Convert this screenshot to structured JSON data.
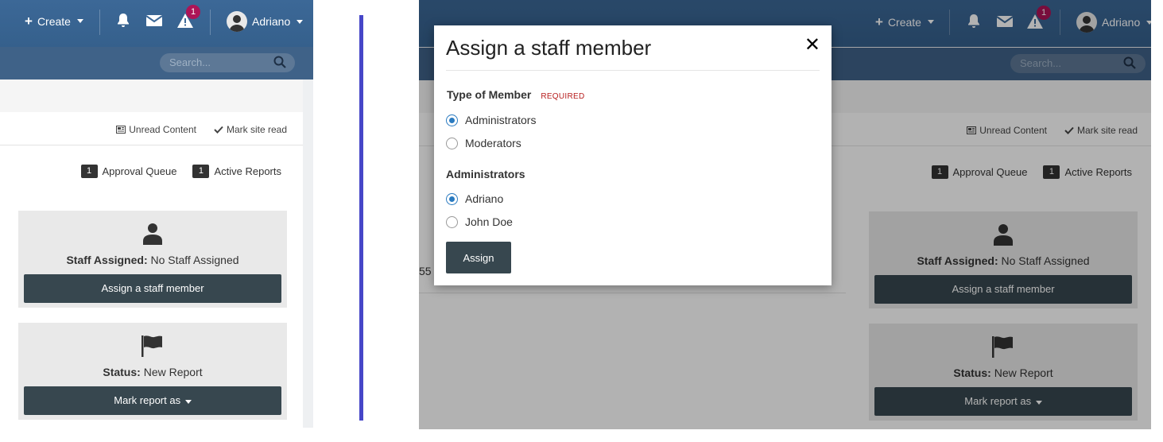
{
  "nav": {
    "create_label": "Create",
    "user_name": "Adriano",
    "alert_badge": "1"
  },
  "search": {
    "placeholder": "Search..."
  },
  "links": {
    "unread": "Unread Content",
    "mark_read": "Mark site read"
  },
  "counts": {
    "approval": {
      "count": "1",
      "label": "Approval Queue"
    },
    "reports": {
      "count": "1",
      "label": "Active Reports"
    }
  },
  "staff_card": {
    "label": "Staff Assigned:",
    "value": "No Staff Assigned",
    "button": "Assign a staff member"
  },
  "status_card": {
    "label": "Status:",
    "value": "New Report",
    "button": "Mark report as"
  },
  "background_fragment": "55",
  "modal": {
    "title": "Assign a staff member",
    "close": "✕",
    "type_label": "Type of Member",
    "required": "REQUIRED",
    "type_options": [
      {
        "label": "Administrators",
        "selected": true
      },
      {
        "label": "Moderators",
        "selected": false
      }
    ],
    "admins_label": "Administrators",
    "admin_options": [
      {
        "label": "Adriano",
        "selected": true
      },
      {
        "label": "John Doe",
        "selected": false
      }
    ],
    "submit": "Assign"
  },
  "colors": {
    "header": "#3c6897",
    "button": "#37474f",
    "badge": "#ad1457",
    "radio": "#2a7ac0",
    "divider": "#4646c8"
  },
  "icons": [
    "plus-icon",
    "bell-icon",
    "envelope-icon",
    "warning-icon",
    "search-icon",
    "newspaper-icon",
    "check-icon",
    "user-icon",
    "flag-icon",
    "close-icon"
  ]
}
